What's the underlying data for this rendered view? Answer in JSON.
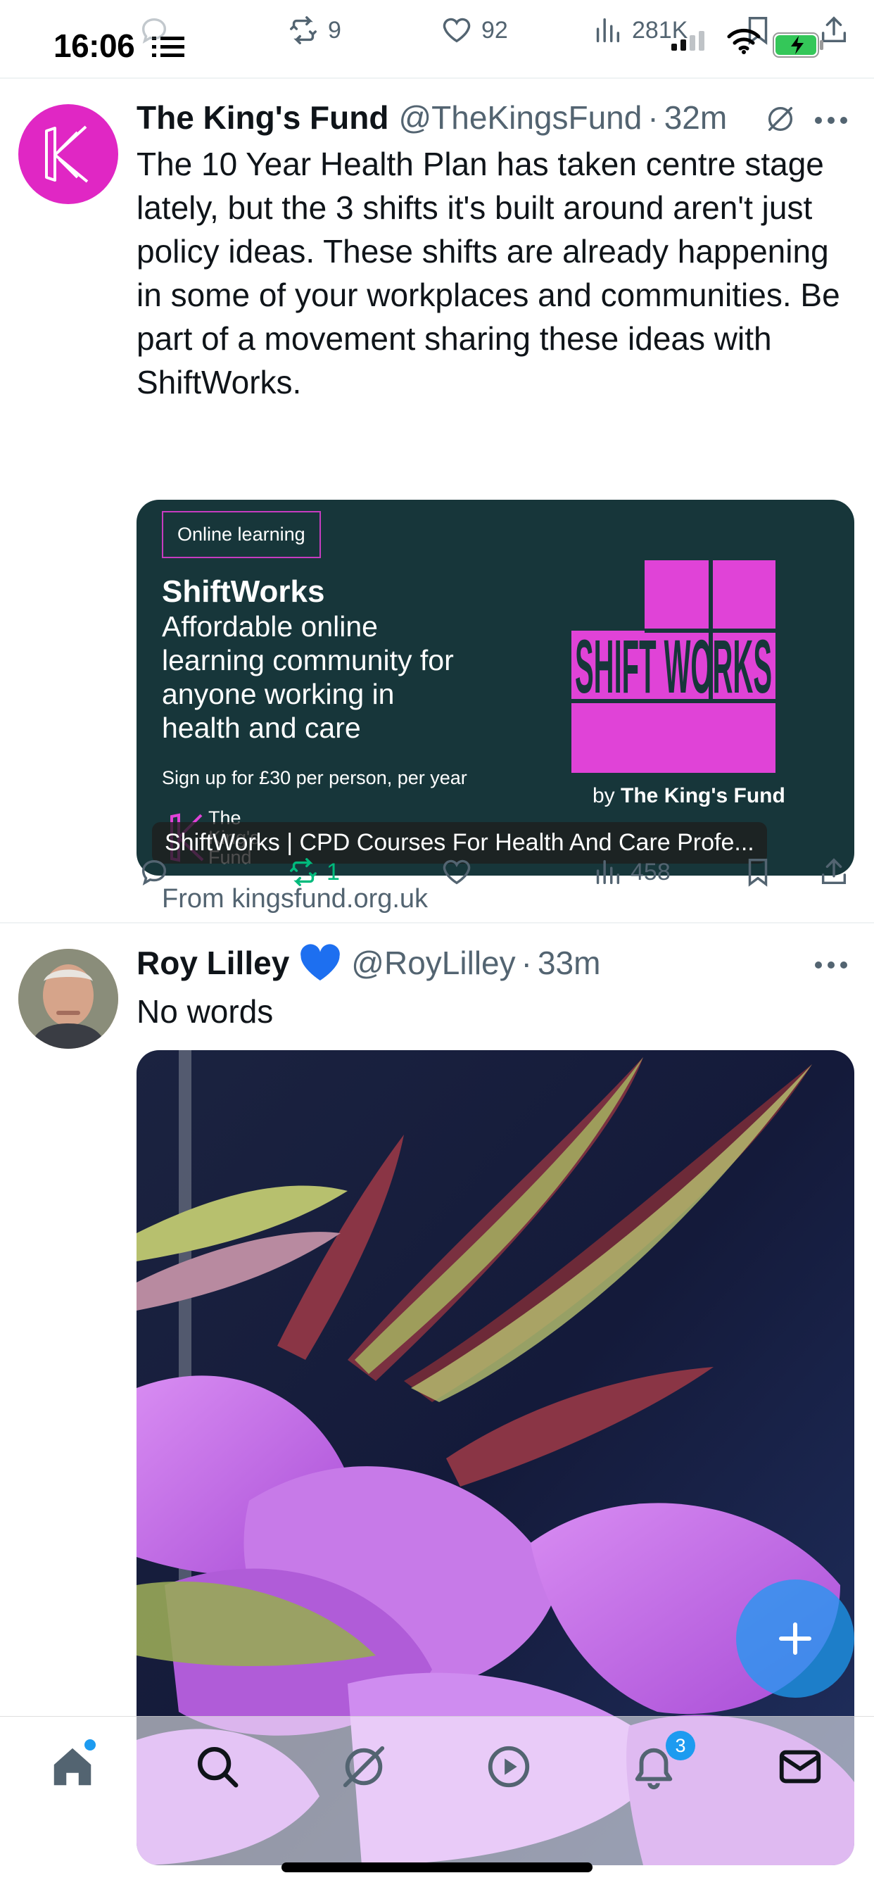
{
  "status_bar": {
    "time": "16:06",
    "icons": [
      "list-icon",
      "signal-icon",
      "wifi-icon",
      "battery-charging-icon"
    ]
  },
  "previous_tweet_actions": {
    "retweets": "9",
    "likes": "92",
    "views": "281K"
  },
  "tweets": [
    {
      "name": "The King's Fund",
      "handle": "@TheKingsFund",
      "separator": "·",
      "time": "32m",
      "text": "The 10 Year Health Plan has taken centre stage lately, but the 3 shifts it's built around aren't just policy ideas. These shifts are already happening in some of your workplaces and communities. Be part of a movement sharing these ideas with ShiftWorks.",
      "card": {
        "badge": "Online learning",
        "title": "ShiftWorks",
        "subtitle": "Affordable online learning community for anyone working in health and care",
        "price": "Sign up for £30 per person, per year",
        "logo_text": "SHIFT WORKS",
        "by_prefix": "by",
        "by_brand": "The King's Fund",
        "mini_logo_text": "The King's Fund",
        "caption": "ShiftWorks | CPD Courses For Health And Care Profe...",
        "from": "From kingsfund.org.uk"
      },
      "actions": {
        "replies": "",
        "retweets": "1",
        "likes": "",
        "views": "458"
      },
      "colors": {
        "avatar_bg": "#e027c4",
        "card_bg": "#17363a",
        "logo_magenta": "#e043d7",
        "retweeted_green": "#00ba7c"
      }
    },
    {
      "name": "Roy Lilley",
      "verified_icon": "blue-heart-icon",
      "handle": "@RoyLilley",
      "separator": "·",
      "time": "33m",
      "text": "No words",
      "media": "photo of pink-purple gladiolus flowers on dark blue background"
    }
  ],
  "tab_bar": {
    "items": [
      "home-icon",
      "search-icon",
      "grok-icon",
      "play-icon",
      "bell-icon",
      "mail-icon"
    ],
    "notifications_badge": "3"
  },
  "fab": {
    "icon": "plus-icon"
  },
  "accent": "#1d9bf0"
}
